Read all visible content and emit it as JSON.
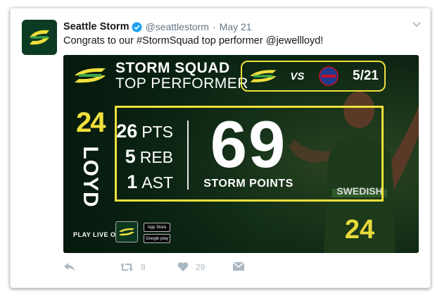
{
  "tweet": {
    "display_name": "Seattle Storm",
    "handle": "@seattlestorm",
    "separator": "·",
    "date": "May 21",
    "text": "Congrats to our #StormSquad top performer @jewellloyd!"
  },
  "graphic": {
    "title_line1": "STORM SQUAD",
    "title_line2": "TOP PERFORMER",
    "matchup_vs": "VS",
    "matchup_date": "5/21",
    "jersey_number": "24",
    "player_name": "LOYD",
    "stats": [
      {
        "value": "26",
        "label": "PTS"
      },
      {
        "value": "5",
        "label": "REB"
      },
      {
        "value": "1",
        "label": "AST"
      }
    ],
    "points_total": "69",
    "points_label": "STORM POINTS",
    "play_live_text": "PLAY LIVE ON",
    "app_store_label": "App Store",
    "google_play_label": "Google play",
    "jersey_sponsor": "SWEDISH",
    "jersey_back_number": "24",
    "accent_color": "#f0e03c"
  },
  "actions": {
    "reply_icon": "reply-icon",
    "retweet_count": "8",
    "like_count": "29",
    "dm_icon": "envelope-icon"
  }
}
